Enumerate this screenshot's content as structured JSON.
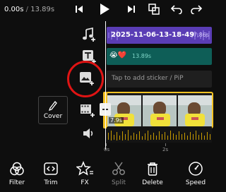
{
  "player": {
    "current_time": "0.00s",
    "separator": "/",
    "total_time": "13.89s"
  },
  "tracks": {
    "audio": {
      "title": "2025-11-06-13-18-49",
      "duration": "7.86s"
    },
    "text": {
      "emoji": "😭❤️",
      "duration": "13.89s"
    },
    "sticker": {
      "placeholder": "Tap to add sticker / PiP"
    },
    "video": {
      "duration": "7.9s"
    }
  },
  "cover_button": {
    "label": "Cover"
  },
  "timeline_ruler": {
    "start": "0s",
    "mark": "2s"
  },
  "toolbar": {
    "items": [
      {
        "label": "Filter"
      },
      {
        "label": "Trim"
      },
      {
        "label": "FX"
      },
      {
        "label": "Split"
      },
      {
        "label": "Delete"
      },
      {
        "label": "Speed"
      }
    ]
  },
  "colors": {
    "background": "#0e0e0e",
    "audio_track": "#5a3db5",
    "text_track": "#0e5e57",
    "sticker_track": "#1f1f1f",
    "video_border": "#f5c324",
    "waveform": "#c89b00",
    "highlight_circle": "#e01414"
  }
}
